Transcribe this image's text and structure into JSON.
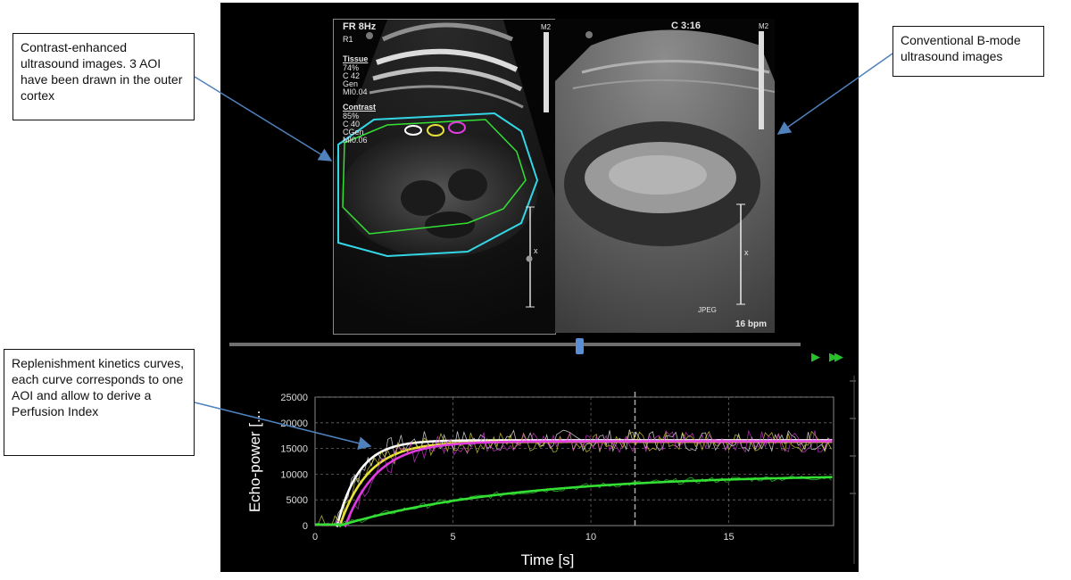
{
  "left_image": {
    "top_left_label": "FR 8Hz",
    "r_label": "R1",
    "m2": "M2",
    "tissue_heading": "Tissue",
    "tissue_lines": [
      "74%",
      "C 42",
      "Gen",
      "MI0.04"
    ],
    "contrast_heading": "Contrast",
    "contrast_lines": [
      "85%",
      "C 40",
      "CGen",
      "MI0.06"
    ],
    "scale_marker": "x"
  },
  "right_image": {
    "top_right_label": "C 3:16",
    "m2": "M2",
    "jpeg": "JPEG",
    "bpm": "16  bpm",
    "scale_marker": "x"
  },
  "callouts": {
    "contrast": "Contrast-enhanced ultrasound images. 3  AOI have been drawn in the outer cortex",
    "bmode": "Conventional B-mode ultrasound images",
    "kinetics": "Replenishment kinetics curves, each curve corresponds to one AOI and allow to derive a Perfusion Index"
  },
  "playback": {
    "play_icon": "play-icon",
    "fast_forward_icon": "fast-forward-icon"
  },
  "colors": {
    "white_aoi": "#ffffff",
    "yellow_aoi": "#e8e23a",
    "magenta_aoi": "#e03ce0",
    "green_roi": "#33e033",
    "cyan_roi": "#34d6e6"
  },
  "chart_data": {
    "type": "line",
    "xlabel": "Time [s]",
    "ylabel": "Echo-power [...",
    "xlim": [
      0,
      18.8
    ],
    "ylim": [
      0,
      25000
    ],
    "x_ticks": [
      "0",
      "5",
      "10",
      "15"
    ],
    "y_ticks": [
      "0",
      "5000",
      "10000",
      "15000",
      "20000",
      "25000"
    ],
    "grid": true,
    "cursor_time": 11.6,
    "series": [
      {
        "color": "#ffffff",
        "plateau": 16600,
        "t0": 0.8,
        "rate": 1.25
      },
      {
        "color": "#e8e23a",
        "plateau": 16300,
        "t0": 0.9,
        "rate": 0.95
      },
      {
        "color": "#e03ce0",
        "plateau": 16400,
        "t0": 1.1,
        "rate": 0.85
      },
      {
        "color": "#33e033",
        "plateau": 10000,
        "t0": 0.9,
        "rate": 0.16
      }
    ]
  }
}
